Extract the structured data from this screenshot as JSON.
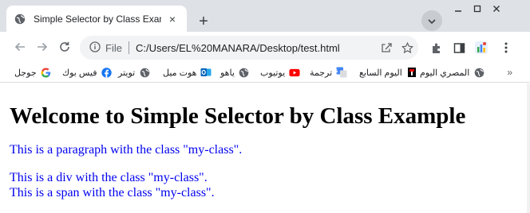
{
  "browser": {
    "tab": {
      "title": "Simple Selector by Class Example",
      "close": "×"
    },
    "new_tab": "+",
    "address": {
      "file_label": "File",
      "url": "C:/Users/EL%20MANARA/Desktop/test.html"
    },
    "bookmarks": [
      {
        "label": "جوجل",
        "icon": "google-icon"
      },
      {
        "label": "فيس بوك",
        "icon": "facebook-icon"
      },
      {
        "label": "تويتر",
        "icon": "globe-icon"
      },
      {
        "label": "هوت ميل",
        "icon": "outlook-icon"
      },
      {
        "label": "ياهو",
        "icon": "globe-icon"
      },
      {
        "label": "يوتيوب",
        "icon": "youtube-icon"
      },
      {
        "label": "ترجمة",
        "icon": "translate-icon"
      },
      {
        "label": "اليوم السابع",
        "icon": "youm7-icon"
      },
      {
        "label": "المصري اليوم",
        "icon": "globe-icon"
      }
    ],
    "bookmarks_more": "»"
  },
  "page": {
    "heading": "Welcome to Simple Selector by Class Example",
    "paragraph": "This is a paragraph with the class \"my-class\".",
    "div_text": "This is a div with the class \"my-class\".",
    "span_text": "This is a span with the class \"my-class\"."
  },
  "colors": {
    "accent": "#0000ee",
    "tabstrip": "#dee1e6",
    "omnibox": "#f1f3f4"
  }
}
